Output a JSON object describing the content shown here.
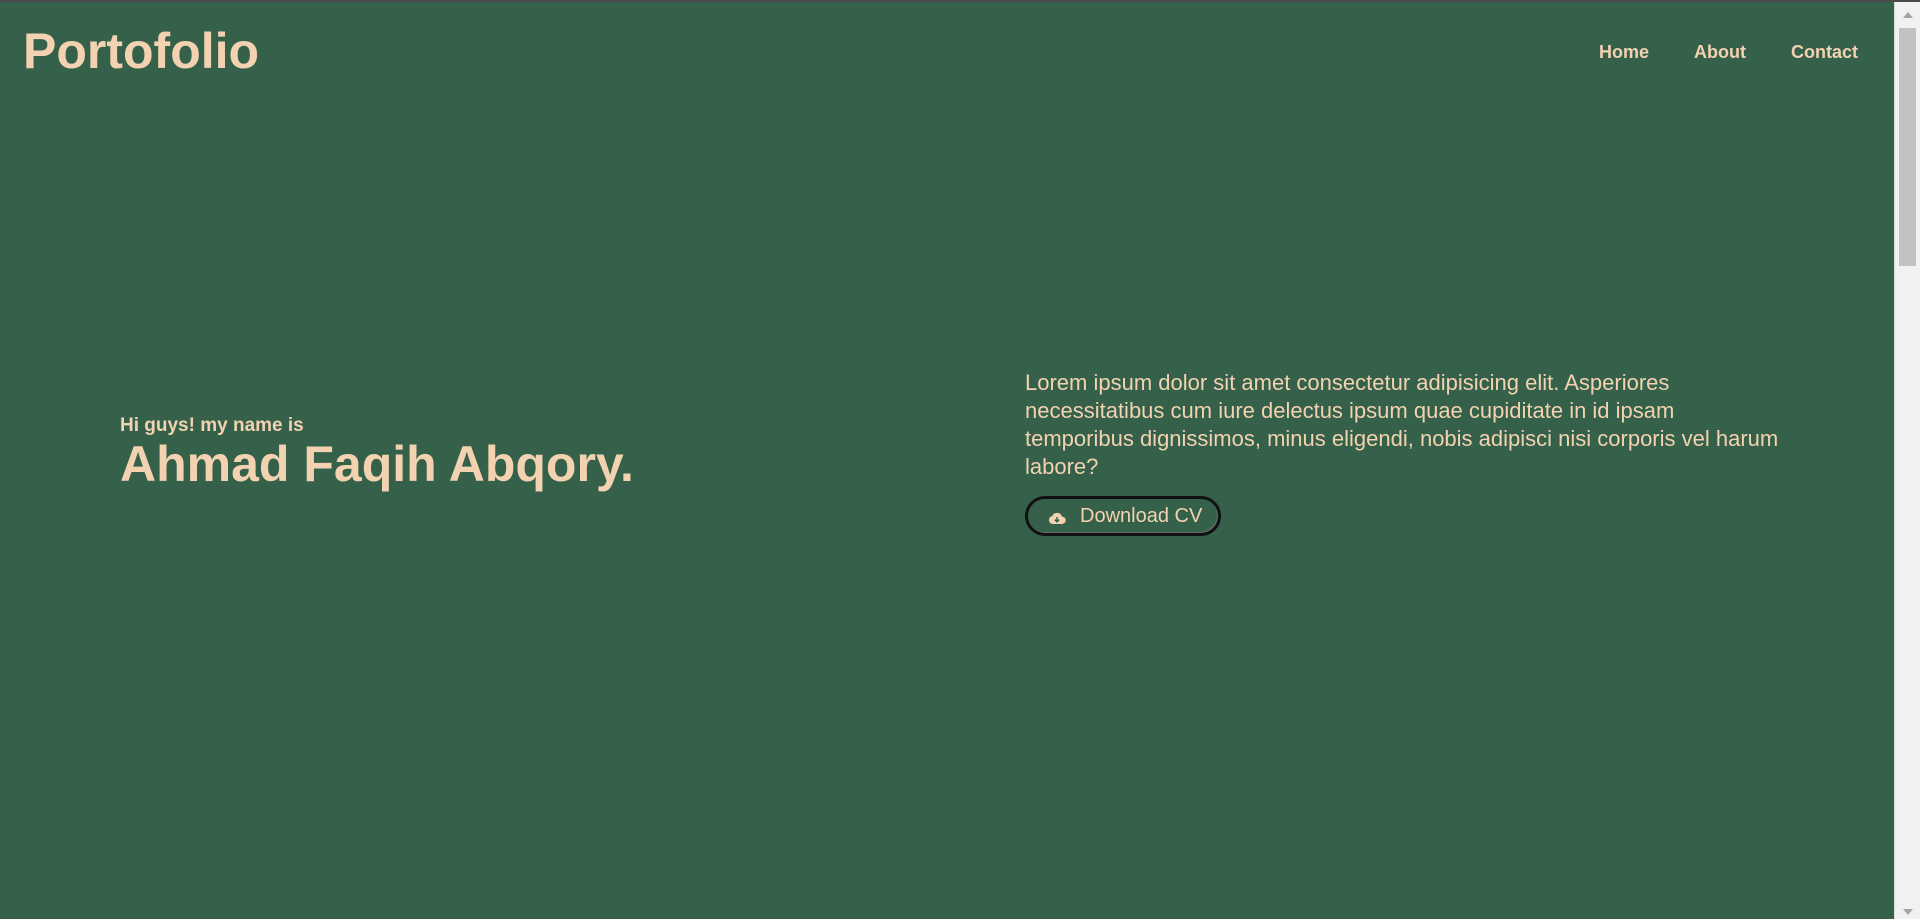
{
  "header": {
    "brand": "Portofolio",
    "nav": [
      {
        "label": "Home"
      },
      {
        "label": "About"
      },
      {
        "label": "Contact"
      }
    ]
  },
  "hero": {
    "greeting": "Hi guys! my name is",
    "name": "Ahmad Faqih Abqory.",
    "bio": "Lorem ipsum dolor sit amet consectetur adipisicing elit. Asperiores necessitatibus cum iure delectus ipsum quae cupiditate in id ipsam temporibus dignissimos, minus eligendi, nobis adipisci nisi corporis vel harum labore?",
    "cv_button": {
      "label": "Download CV",
      "icon": "cloud-download-icon"
    }
  },
  "colors": {
    "background": "#35614a",
    "accent_text": "#f2d2b0"
  }
}
